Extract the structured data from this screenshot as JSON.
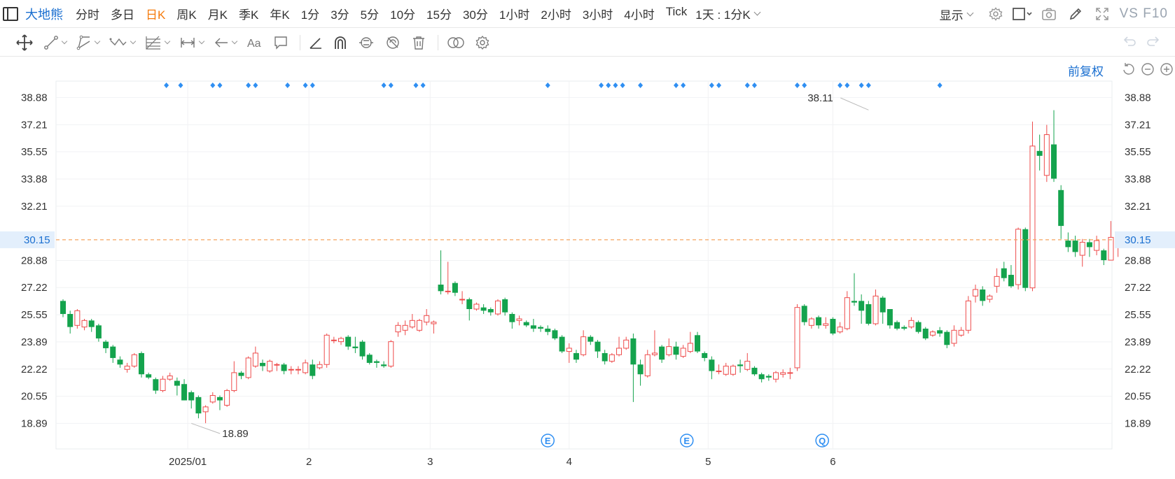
{
  "header": {
    "stock_name": "大地熊",
    "periods": [
      {
        "label": "分时",
        "active": false
      },
      {
        "label": "多日",
        "active": false
      },
      {
        "label": "日K",
        "active": true
      },
      {
        "label": "周K",
        "active": false
      },
      {
        "label": "月K",
        "active": false
      },
      {
        "label": "季K",
        "active": false
      },
      {
        "label": "年K",
        "active": false
      },
      {
        "label": "1分",
        "active": false
      },
      {
        "label": "3分",
        "active": false
      },
      {
        "label": "5分",
        "active": false
      },
      {
        "label": "10分",
        "active": false
      },
      {
        "label": "15分",
        "active": false
      },
      {
        "label": "30分",
        "active": false
      },
      {
        "label": "1小时",
        "active": false
      },
      {
        "label": "2小时",
        "active": false
      },
      {
        "label": "3小时",
        "active": false
      },
      {
        "label": "4小时",
        "active": false
      },
      {
        "label": "Tick",
        "active": false
      }
    ],
    "mode_label": "1天 : 1分K",
    "display_label": "显示",
    "vs_label": "VS",
    "f10_label": "F10",
    "icons": [
      "settings-icon",
      "square-icon",
      "camera-icon",
      "pen-icon",
      "fullscreen-icon"
    ]
  },
  "drawing_tools": [
    "move-icon",
    "line-icon",
    "channel-icon",
    "wave-icon",
    "fib-icon",
    "measure-icon",
    "arrow-icon",
    "text-icon",
    "comment-icon",
    "angle-icon",
    "magnet-icon",
    "lock-icon",
    "hide-icon",
    "trash-icon",
    "link-icon",
    "gear-icon"
  ],
  "adjust": {
    "label": "前复权"
  },
  "colors": {
    "up": "#ee4b4b",
    "down": "#14a34d",
    "marker": "#2f8ff2",
    "current_line": "#f5a35f",
    "accent": "#1a6fd0",
    "active_period": "#f57a0c"
  },
  "chart_data": {
    "type": "candlestick",
    "y_ticks": [
      38.88,
      37.21,
      35.55,
      33.88,
      32.21,
      28.88,
      27.22,
      25.55,
      23.89,
      22.22,
      20.55,
      18.89
    ],
    "ylim": [
      17.6,
      39.9
    ],
    "current_price": 30.15,
    "x_labels": [
      "2025/01",
      "2",
      "3",
      "4",
      "5",
      "6"
    ],
    "x_label_candles": [
      17.5,
      34.5,
      51.5,
      71,
      90.5,
      108
    ],
    "max_label": {
      "value": 38.11,
      "candle": 113
    },
    "min_label": {
      "value": 18.89,
      "candle": 18
    },
    "event_markers": [
      {
        "symbol": "E",
        "candle": 68
      },
      {
        "symbol": "E",
        "candle": 87.5
      },
      {
        "symbol": "Q",
        "candle": 106.5
      }
    ],
    "top_markers": [
      14.5,
      16.5,
      21,
      22,
      26,
      27,
      31.5,
      34,
      35,
      45,
      46,
      49.5,
      50.5,
      68,
      75.5,
      76.5,
      77.5,
      78.5,
      81,
      86,
      87,
      91,
      92,
      96,
      97,
      103,
      104,
      109,
      110,
      112,
      113,
      123
    ],
    "candles": [
      [
        26.4,
        25.6,
        26.5,
        25.4
      ],
      [
        25.6,
        24.8,
        25.8,
        24.4
      ],
      [
        24.9,
        25.8,
        25.9,
        24.7
      ],
      [
        24.8,
        25.2,
        25.3,
        24.6
      ],
      [
        25.2,
        24.8,
        25.3,
        24.5
      ],
      [
        24.9,
        24.1,
        25.0,
        23.9
      ],
      [
        23.9,
        23.5,
        24.0,
        23.2
      ],
      [
        23.6,
        22.9,
        23.7,
        22.6
      ],
      [
        22.8,
        22.5,
        23.0,
        22.3
      ],
      [
        22.2,
        22.4,
        22.6,
        22.0
      ],
      [
        22.4,
        23.1,
        23.2,
        22.3
      ],
      [
        23.2,
        21.9,
        23.3,
        21.7
      ],
      [
        21.9,
        21.7,
        22.0,
        21.6
      ],
      [
        21.6,
        20.9,
        21.7,
        20.7
      ],
      [
        20.9,
        21.6,
        21.8,
        20.8
      ],
      [
        21.6,
        21.8,
        22.0,
        21.5
      ],
      [
        21.5,
        21.2,
        21.7,
        20.6
      ],
      [
        21.3,
        20.3,
        21.6,
        20.3
      ],
      [
        20.8,
        20.3,
        20.9,
        19.8
      ],
      [
        20.5,
        19.5,
        20.6,
        19.2
      ],
      [
        19.6,
        19.9,
        20.0,
        18.9
      ],
      [
        20.2,
        20.6,
        20.8,
        20.1
      ],
      [
        20.5,
        20.3,
        20.6,
        19.7
      ],
      [
        20.0,
        20.9,
        21.0,
        19.9
      ],
      [
        20.9,
        22.0,
        22.7,
        20.8
      ],
      [
        22.0,
        21.8,
        22.1,
        21.6
      ],
      [
        21.7,
        22.9,
        23.0,
        21.6
      ],
      [
        22.4,
        23.2,
        23.6,
        22.3
      ],
      [
        22.6,
        22.4,
        22.8,
        22.1
      ],
      [
        22.1,
        22.7,
        22.8,
        22.0
      ],
      [
        22.5,
        22.5,
        22.6,
        22.1
      ],
      [
        22.5,
        22.1,
        22.6,
        21.9
      ],
      [
        22.2,
        22.2,
        22.4,
        21.9
      ],
      [
        22.2,
        22.2,
        22.4,
        21.9
      ],
      [
        22.0,
        22.6,
        22.8,
        21.9
      ],
      [
        22.5,
        21.8,
        22.8,
        21.6
      ],
      [
        22.3,
        22.5,
        22.7,
        22.2
      ],
      [
        22.5,
        24.3,
        24.4,
        22.3
      ],
      [
        24.0,
        24.0,
        24.2,
        23.8
      ],
      [
        23.9,
        24.1,
        24.2,
        23.7
      ],
      [
        24.2,
        23.6,
        24.3,
        23.4
      ],
      [
        23.6,
        23.5,
        24.2,
        23.2
      ],
      [
        23.9,
        23.0,
        24.0,
        22.8
      ],
      [
        23.1,
        22.6,
        23.2,
        22.5
      ],
      [
        22.7,
        22.6,
        22.8,
        22.3
      ],
      [
        22.5,
        22.4,
        22.7,
        22.3
      ],
      [
        22.4,
        23.9,
        24.0,
        22.3
      ],
      [
        24.5,
        24.9,
        25.1,
        24.2
      ],
      [
        24.6,
        24.9,
        25.2,
        24.3
      ],
      [
        24.8,
        25.2,
        25.6,
        24.7
      ],
      [
        24.6,
        25.2,
        25.3,
        24.5
      ],
      [
        25.1,
        25.5,
        25.9,
        24.9
      ],
      [
        25.0,
        25.1,
        25.2,
        24.4
      ],
      [
        27.4,
        27.0,
        29.5,
        26.8
      ],
      [
        27.0,
        27.0,
        28.8,
        26.8
      ],
      [
        27.5,
        26.9,
        27.6,
        26.7
      ],
      [
        26.5,
        26.5,
        27.0,
        26.2
      ],
      [
        26.5,
        25.9,
        26.6,
        25.2
      ],
      [
        25.9,
        26.2,
        26.3,
        25.8
      ],
      [
        26.0,
        25.8,
        26.2,
        25.6
      ],
      [
        25.9,
        25.7,
        26.0,
        25.5
      ],
      [
        25.6,
        26.4,
        26.5,
        25.5
      ],
      [
        26.5,
        25.7,
        26.6,
        25.5
      ],
      [
        25.6,
        25.1,
        25.7,
        24.7
      ],
      [
        25.2,
        25.3,
        25.5,
        24.9
      ],
      [
        25.1,
        24.9,
        25.2,
        24.8
      ],
      [
        24.9,
        24.7,
        25.3,
        24.5
      ],
      [
        24.8,
        24.7,
        24.9,
        24.5
      ],
      [
        24.7,
        24.5,
        24.9,
        24.3
      ],
      [
        24.6,
        24.1,
        24.7,
        24.0
      ],
      [
        24.2,
        23.3,
        24.3,
        23.2
      ],
      [
        23.3,
        23.5,
        23.8,
        22.6
      ],
      [
        23.2,
        22.8,
        23.4,
        22.6
      ],
      [
        23.1,
        24.2,
        24.6,
        23.0
      ],
      [
        24.2,
        23.9,
        24.3,
        23.7
      ],
      [
        23.9,
        23.3,
        24.0,
        22.9
      ],
      [
        23.2,
        22.7,
        23.4,
        22.5
      ],
      [
        22.7,
        23.1,
        23.2,
        22.6
      ],
      [
        23.1,
        23.5,
        24.2,
        23.0
      ],
      [
        23.5,
        24.0,
        24.2,
        23.4
      ],
      [
        24.1,
        22.5,
        24.4,
        20.2
      ],
      [
        22.5,
        21.9,
        22.8,
        21.2
      ],
      [
        21.8,
        23.1,
        23.4,
        21.7
      ],
      [
        23.1,
        23.2,
        24.6,
        23.0
      ],
      [
        23.6,
        22.8,
        23.7,
        22.6
      ],
      [
        23.1,
        23.6,
        24.1,
        23.0
      ],
      [
        23.6,
        23.1,
        23.9,
        22.8
      ],
      [
        23.0,
        23.5,
        23.7,
        22.9
      ],
      [
        23.3,
        23.8,
        24.5,
        23.2
      ],
      [
        24.3,
        23.3,
        24.5,
        23.2
      ],
      [
        23.2,
        22.9,
        23.3,
        22.7
      ],
      [
        22.8,
        22.1,
        23.0,
        21.6
      ],
      [
        22.1,
        22.1,
        22.5,
        21.9
      ],
      [
        21.9,
        22.4,
        22.6,
        21.8
      ],
      [
        21.9,
        22.4,
        22.5,
        21.8
      ],
      [
        22.5,
        22.4,
        22.8,
        22.0
      ],
      [
        22.2,
        22.7,
        23.2,
        22.1
      ],
      [
        22.3,
        21.9,
        22.4,
        21.8
      ],
      [
        21.9,
        21.6,
        22.0,
        21.4
      ],
      [
        21.8,
        21.7,
        21.9,
        21.5
      ],
      [
        21.6,
        22.0,
        22.1,
        21.4
      ],
      [
        21.9,
        22.0,
        22.2,
        21.7
      ],
      [
        22.0,
        22.0,
        22.3,
        21.6
      ],
      [
        22.3,
        26.0,
        26.2,
        22.1
      ],
      [
        26.1,
        25.1,
        26.2,
        24.9
      ],
      [
        24.9,
        25.3,
        25.4,
        24.7
      ],
      [
        25.4,
        24.9,
        25.5,
        24.7
      ],
      [
        24.9,
        25.0,
        25.4,
        24.7
      ],
      [
        25.3,
        24.4,
        25.4,
        24.3
      ],
      [
        24.5,
        24.8,
        25.1,
        24.4
      ],
      [
        24.7,
        26.6,
        27.0,
        24.6
      ],
      [
        26.4,
        26.3,
        28.1,
        26.1
      ],
      [
        26.4,
        25.8,
        26.8,
        25.0
      ],
      [
        26.2,
        25.0,
        26.4,
        24.9
      ],
      [
        25.0,
        26.7,
        27.1,
        24.9
      ],
      [
        26.6,
        25.7,
        26.7,
        25.0
      ],
      [
        25.9,
        24.9,
        25.9,
        24.7
      ],
      [
        25.1,
        24.7,
        25.2,
        24.6
      ],
      [
        24.8,
        24.7,
        24.9,
        24.6
      ],
      [
        24.8,
        25.2,
        25.4,
        24.7
      ],
      [
        25.1,
        24.5,
        25.2,
        24.4
      ],
      [
        24.7,
        24.1,
        24.8,
        24.0
      ],
      [
        24.3,
        24.5,
        24.6,
        24.2
      ],
      [
        24.6,
        24.4,
        24.8,
        24.2
      ],
      [
        24.5,
        23.7,
        24.6,
        23.5
      ],
      [
        23.8,
        24.6,
        24.9,
        23.6
      ],
      [
        24.3,
        24.6,
        24.8,
        24.2
      ],
      [
        24.6,
        26.4,
        26.7,
        24.4
      ],
      [
        26.7,
        27.1,
        27.4,
        26.3
      ],
      [
        27.1,
        26.4,
        27.3,
        26.1
      ],
      [
        26.5,
        26.7,
        26.8,
        26.3
      ],
      [
        27.3,
        27.9,
        28.4,
        26.9
      ],
      [
        28.4,
        27.8,
        28.8,
        27.6
      ],
      [
        28.0,
        27.3,
        28.6,
        27.2
      ],
      [
        27.4,
        30.8,
        30.9,
        27.1
      ],
      [
        30.8,
        27.2,
        30.9,
        27.0
      ],
      [
        27.2,
        35.9,
        37.4,
        27.0
      ],
      [
        35.6,
        35.3,
        36.6,
        34.4
      ],
      [
        34.1,
        36.6,
        37.2,
        33.7
      ],
      [
        36.0,
        33.9,
        38.1,
        33.7
      ],
      [
        33.2,
        31.0,
        33.5,
        30.2
      ],
      [
        30.1,
        29.7,
        30.6,
        29.4
      ],
      [
        30.1,
        29.4,
        30.4,
        29.1
      ],
      [
        29.2,
        30.0,
        30.2,
        28.5
      ],
      [
        30.0,
        29.7,
        30.2,
        29.1
      ],
      [
        29.5,
        30.1,
        30.4,
        29.2
      ],
      [
        29.5,
        28.9,
        29.6,
        28.6
      ],
      [
        28.9,
        30.3,
        31.3,
        28.9
      ],
      [
        29.9,
        30.1,
        30.2,
        29.1
      ]
    ]
  }
}
